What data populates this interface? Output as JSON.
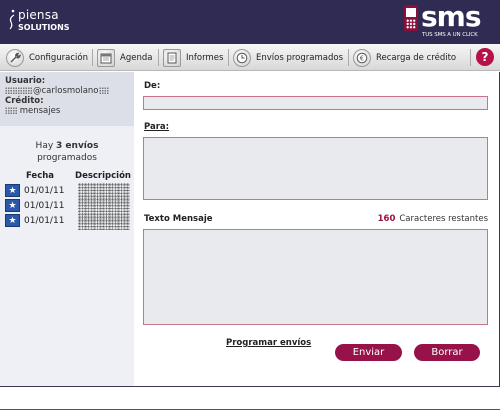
{
  "header": {
    "brand_line1": "piensa",
    "brand_line2": "SOLUTIONS",
    "product": "sms",
    "product_tagline": "TUS SMS A UN CLICK",
    "accent_color": "#98124a",
    "bg_color": "#2f2b52"
  },
  "toolbar": {
    "items": [
      {
        "label": "Configuración",
        "icon": "wrench-icon"
      },
      {
        "label": "Agenda",
        "icon": "calendar-icon"
      },
      {
        "label": "Informes",
        "icon": "document-icon"
      },
      {
        "label": "Envíos programados",
        "icon": "clock-icon"
      },
      {
        "label": "Recarga de crédito",
        "icon": "coin-icon"
      }
    ],
    "help_label": "?"
  },
  "sidebar": {
    "user_label": "Usuario:",
    "user_value": "@carlosmolano",
    "credit_label": "Crédito:",
    "credit_value": "mensajes",
    "envios_prefix": "Hay",
    "envios_count": "3 envíos",
    "envios_suffix": "programados",
    "table": {
      "headers": [
        "Fecha",
        "Descripción"
      ],
      "rows": [
        {
          "date": "01/01/11"
        },
        {
          "date": "01/01/11"
        },
        {
          "date": "01/01/11"
        }
      ]
    }
  },
  "form": {
    "from_label": "De:",
    "to_label": "Para:",
    "message_label": "Texto Mensaje",
    "chars_remaining": "160",
    "chars_label": "Caracteres restantes",
    "schedule_link": "Programar envíos",
    "send_label": "Enviar",
    "clear_label": "Borrar",
    "from_value": "",
    "to_value": "",
    "message_value": ""
  }
}
